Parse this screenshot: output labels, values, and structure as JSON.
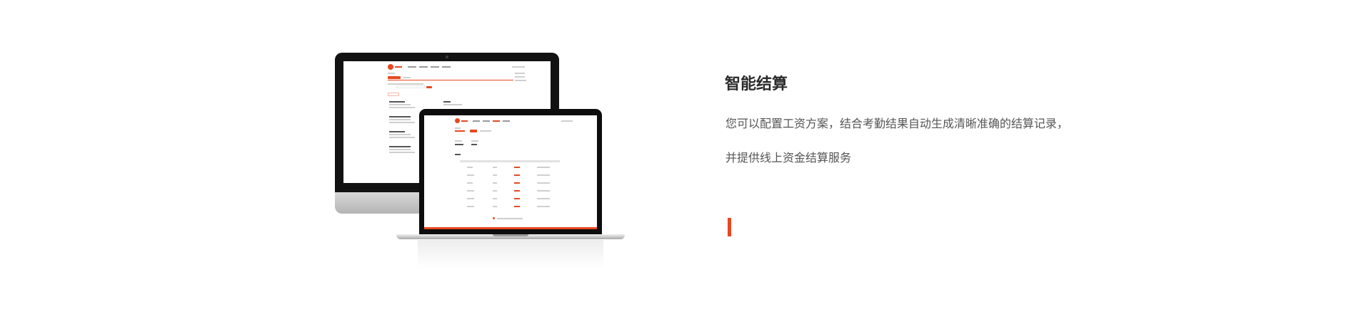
{
  "feature": {
    "title": "智能结算",
    "description_line_1": "您可以配置工资方案，结合考勤结果自动生成清晰准确的结算记录，",
    "description_line_2": "并提供线上资金结算服务"
  },
  "devices": {
    "monitor": "desktop-monitor",
    "laptop": "laptop"
  },
  "colors": {
    "accent": "#e8481f",
    "title_text": "#2b2b2b",
    "body_text": "#555555",
    "background": "#ffffff"
  }
}
